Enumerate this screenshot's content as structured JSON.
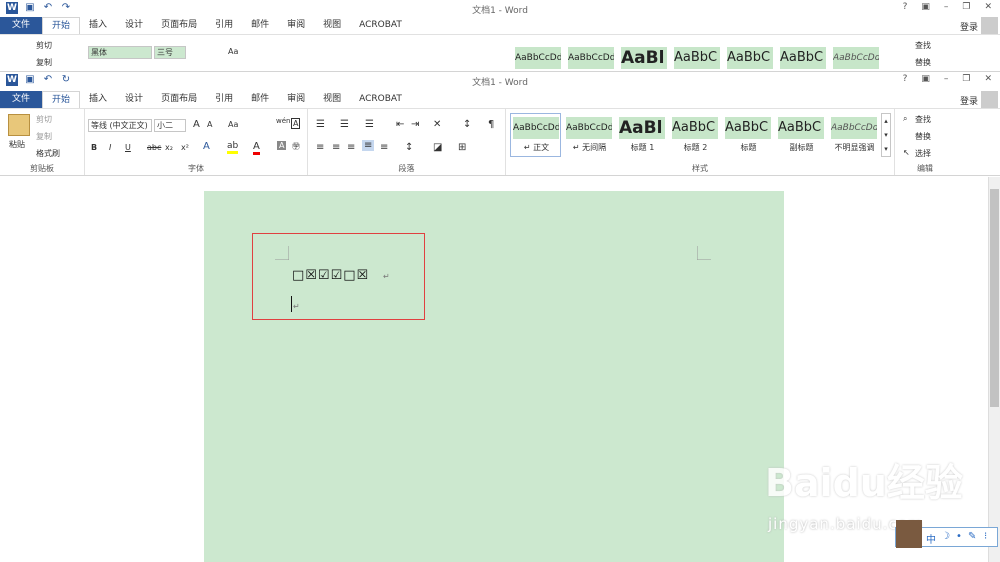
{
  "window": {
    "title": "文档1 - Word",
    "login": "登录",
    "controls": [
      "?",
      "▣",
      "–",
      "❐",
      "✕"
    ]
  },
  "tabs": [
    "文件",
    "开始",
    "插入",
    "设计",
    "页面布局",
    "引用",
    "邮件",
    "审阅",
    "视图",
    "ACROBAT"
  ],
  "clipboard": {
    "paste": "粘贴",
    "cut": "剪切",
    "copy": "复制",
    "painter": "格式刷",
    "label": "剪贴板"
  },
  "font": {
    "name_top": "黑体",
    "size_top": "三号",
    "name": "等线 (中文正文)",
    "size": "小二",
    "grow": "A",
    "shrink": "A",
    "case": "Aa",
    "label": "字体",
    "bold": "B",
    "italic": "I",
    "underline": "U",
    "strike": "abc",
    "sub": "x₂",
    "sup": "x²",
    "pinyin": "wén",
    "border_char": "A"
  },
  "paragraph": {
    "label": "段落"
  },
  "styles": {
    "label": "样式",
    "items": [
      {
        "sample": "AaBbCcDd",
        "name": "↵ 正文"
      },
      {
        "sample": "AaBbCcDd",
        "name": "↵ 无间隔"
      },
      {
        "sample": "AaBl",
        "name": "标题 1"
      },
      {
        "sample": "AaBbC",
        "name": "标题 2"
      },
      {
        "sample": "AaBbC",
        "name": "标题"
      },
      {
        "sample": "AaBbC",
        "name": "副标题"
      },
      {
        "sample": "AaBbCcDd",
        "name": "不明显强调"
      }
    ]
  },
  "editing": {
    "find": "查找",
    "replace": "替换",
    "select": "选择",
    "label": "编辑"
  },
  "document": {
    "checkbox_line": "□☒☑☑□☒",
    "para_mark": "↵"
  },
  "watermark": {
    "brand": "Baidu经验",
    "url": "jingyan.baidu.com"
  },
  "ime": {
    "mode": "中"
  }
}
